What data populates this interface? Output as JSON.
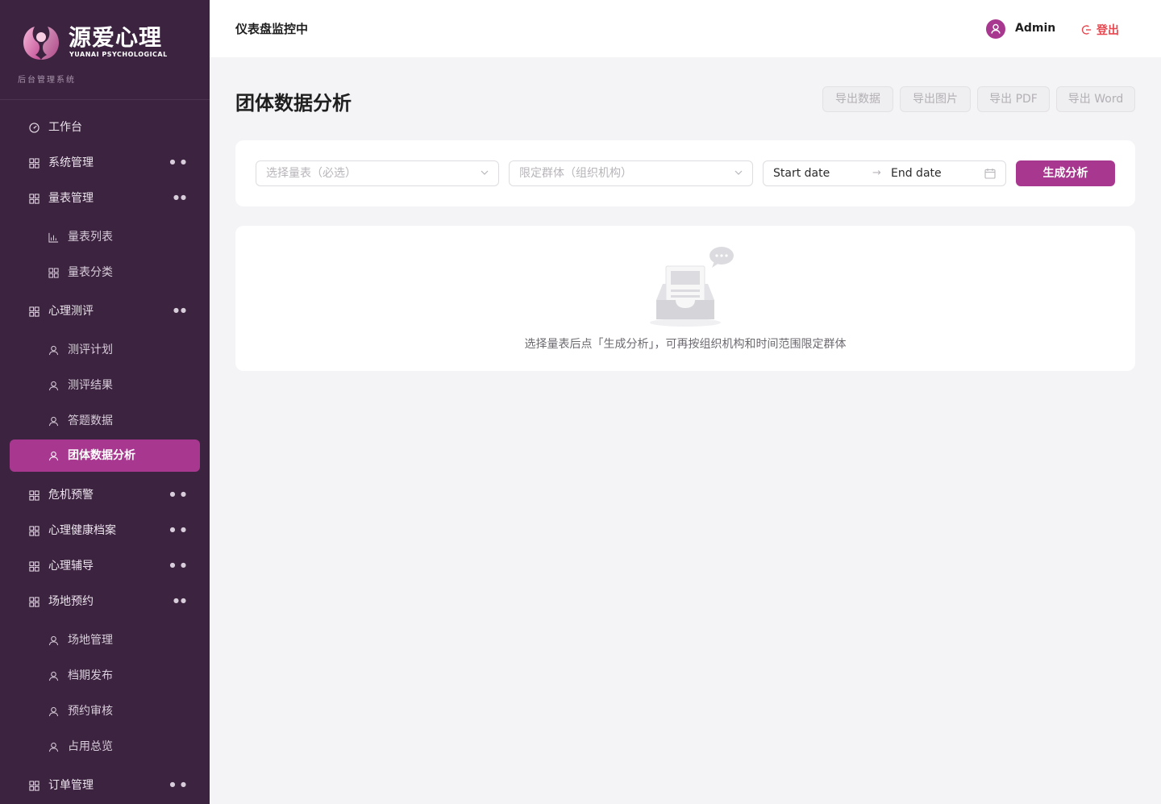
{
  "brand": {
    "name": "源爱心理",
    "sub": "YUANAI PSYCHOLOGICAL",
    "system": "后台管理系统"
  },
  "sidebar": {
    "items": [
      {
        "label": "工作台",
        "icon": "dashboard-icon"
      },
      {
        "label": "系统管理",
        "icon": "grid-icon",
        "collapsed": true
      },
      {
        "label": "量表管理",
        "icon": "grid-icon",
        "expanded": true
      },
      {
        "label": "量表列表",
        "icon": "bar-chart-icon",
        "sub": true
      },
      {
        "label": "量表分类",
        "icon": "grid-icon",
        "sub": true
      },
      {
        "label": "心理测评",
        "icon": "grid-icon",
        "expanded": true
      },
      {
        "label": "测评计划",
        "icon": "user-icon",
        "sub": true
      },
      {
        "label": "测评结果",
        "icon": "user-icon",
        "sub": true
      },
      {
        "label": "答题数据",
        "icon": "user-icon",
        "sub": true
      },
      {
        "label": "团体数据分析",
        "icon": "user-icon",
        "sub": true,
        "active": true
      },
      {
        "label": "危机预警",
        "icon": "grid-icon",
        "collapsed": true
      },
      {
        "label": "心理健康档案",
        "icon": "grid-icon",
        "collapsed": true
      },
      {
        "label": "心理辅导",
        "icon": "grid-icon",
        "collapsed": true
      },
      {
        "label": "场地预约",
        "icon": "grid-icon",
        "expanded": true
      },
      {
        "label": "场地管理",
        "icon": "user-icon",
        "sub": true
      },
      {
        "label": "档期发布",
        "icon": "user-icon",
        "sub": true
      },
      {
        "label": "预约审核",
        "icon": "user-icon",
        "sub": true
      },
      {
        "label": "占用总览",
        "icon": "user-icon",
        "sub": true
      },
      {
        "label": "订单管理",
        "icon": "grid-icon",
        "collapsed": true
      }
    ]
  },
  "header": {
    "title": "仪表盘监控中",
    "user": "Admin",
    "logout": "登出"
  },
  "page": {
    "title": "团体数据分析",
    "exports": [
      "导出数据",
      "导出图片",
      "导出 PDF",
      "导出 Word"
    ]
  },
  "filters": {
    "scale_placeholder": "选择量表（必选）",
    "group_placeholder": "限定群体（组织机构）",
    "start_date": "Start date",
    "end_date": "End date",
    "arrow": "→",
    "generate": "生成分析"
  },
  "empty": {
    "text": "选择量表后点「生成分析」，可再按组织机构和时间范围限定群体"
  },
  "colors": {
    "sidebar_bg": "#3c2340",
    "accent": "#a8378f",
    "logout": "#e8474f"
  }
}
